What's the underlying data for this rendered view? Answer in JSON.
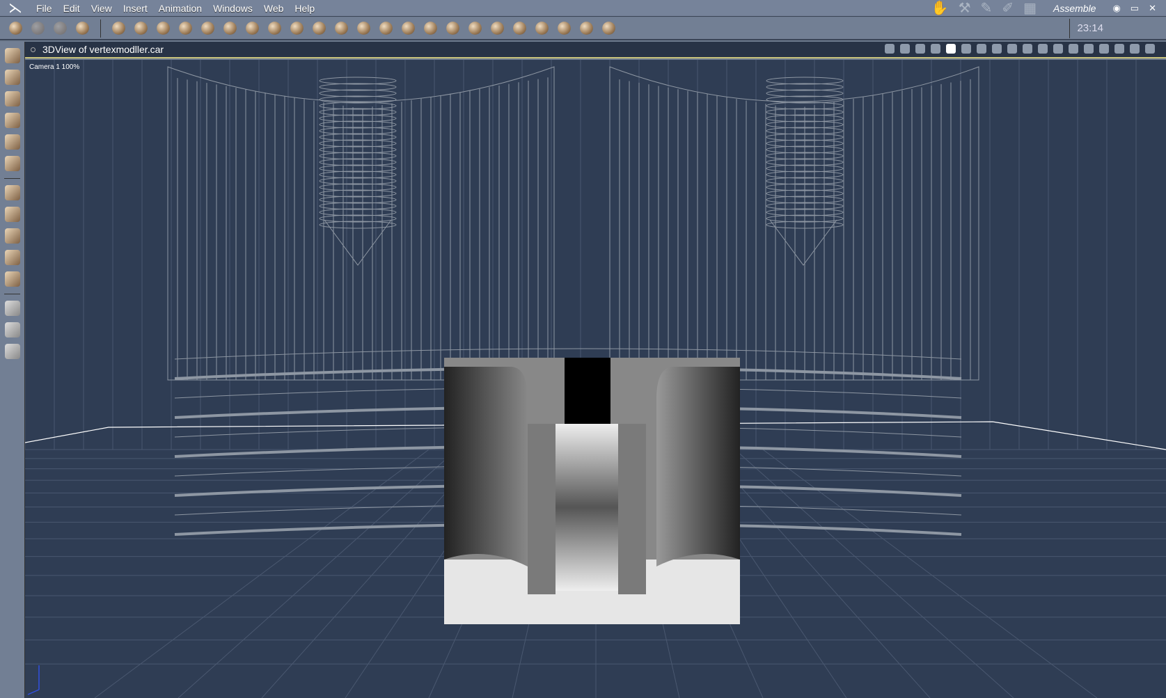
{
  "menubar": {
    "items": [
      "File",
      "Edit",
      "View",
      "Insert",
      "Animation",
      "Windows",
      "Web",
      "Help"
    ],
    "mode": "Assemble"
  },
  "toolbar": {
    "clock": "23:14"
  },
  "viewport": {
    "title": "3DView of vertexmodller.car",
    "camera": "Camera 1 100%"
  },
  "colors": {
    "bg": "#2f3d54",
    "chrome": "#727f94",
    "wire": "#9aa3ae"
  }
}
